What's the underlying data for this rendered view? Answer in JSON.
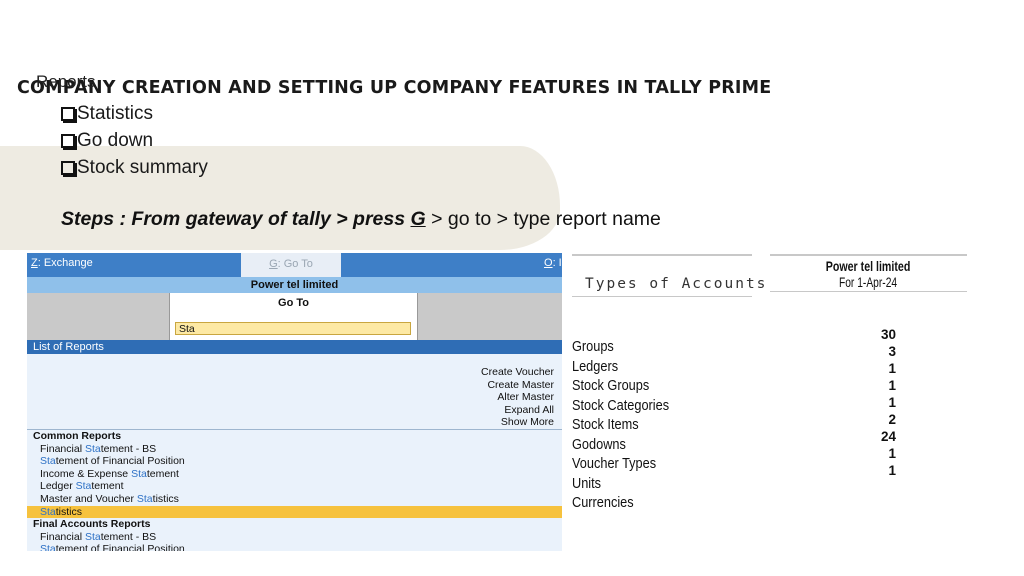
{
  "slide": {
    "title": "COMPANY CREATION AND SETTING UP COMPANY FEATURES IN TALLY PRIME",
    "overlap_label": "Reports",
    "bullets": [
      "Statistics",
      "Go down",
      "Stock summary"
    ],
    "steps_prefix": "Steps : From gateway of tally > press ",
    "steps_key": "G",
    "steps_suffix": " > go to > type report name"
  },
  "tally": {
    "top_bar": {
      "exchange_key": "Z",
      "exchange_label": ": Exchange",
      "goto_key": "G",
      "goto_label": ": Go To",
      "o_key": "O",
      "o_label": ": I"
    },
    "company": "Power tel limited",
    "goto_title": "Go To",
    "search_value": "Sta",
    "list_header": "List of Reports",
    "actions": [
      "Create Voucher",
      "Create Master",
      "Alter Master",
      "Expand All",
      "Show More"
    ],
    "sections": [
      {
        "label": "Common Reports",
        "items": [
          {
            "pre": "Financial ",
            "hl": "Sta",
            "post": "tement - BS"
          },
          {
            "pre": "",
            "hl": "Sta",
            "post": "tement of Financial Position"
          },
          {
            "pre": "Income & Expense ",
            "hl": "Sta",
            "post": "tement"
          },
          {
            "pre": "Ledger ",
            "hl": "Sta",
            "post": "tement"
          },
          {
            "pre": "Master and Voucher ",
            "hl": "Sta",
            "post": "tistics"
          },
          {
            "pre": "",
            "hl": "Sta",
            "post": "tistics",
            "selected": true
          }
        ]
      },
      {
        "label": "Final Accounts Reports",
        "items": [
          {
            "pre": "Financial ",
            "hl": "Sta",
            "post": "tement - BS"
          },
          {
            "pre": "",
            "hl": "Sta",
            "post": "tement of Financial Position"
          }
        ]
      }
    ]
  },
  "statistics": {
    "types_title": "Types of Accounts",
    "company": "Power tel limited",
    "date": "For 1-Apr-24",
    "rows": [
      {
        "label": "Groups",
        "count": "30"
      },
      {
        "label": "Ledgers",
        "count": "3"
      },
      {
        "label": "Stock Groups",
        "count": "1"
      },
      {
        "label": "Stock Categories",
        "count": "1"
      },
      {
        "label": "Stock Items",
        "count": "1"
      },
      {
        "label": "Godowns",
        "count": "2"
      },
      {
        "label": "Voucher Types",
        "count": "24"
      },
      {
        "label": "Units",
        "count": "1"
      },
      {
        "label": "Currencies",
        "count": "1"
      }
    ]
  }
}
